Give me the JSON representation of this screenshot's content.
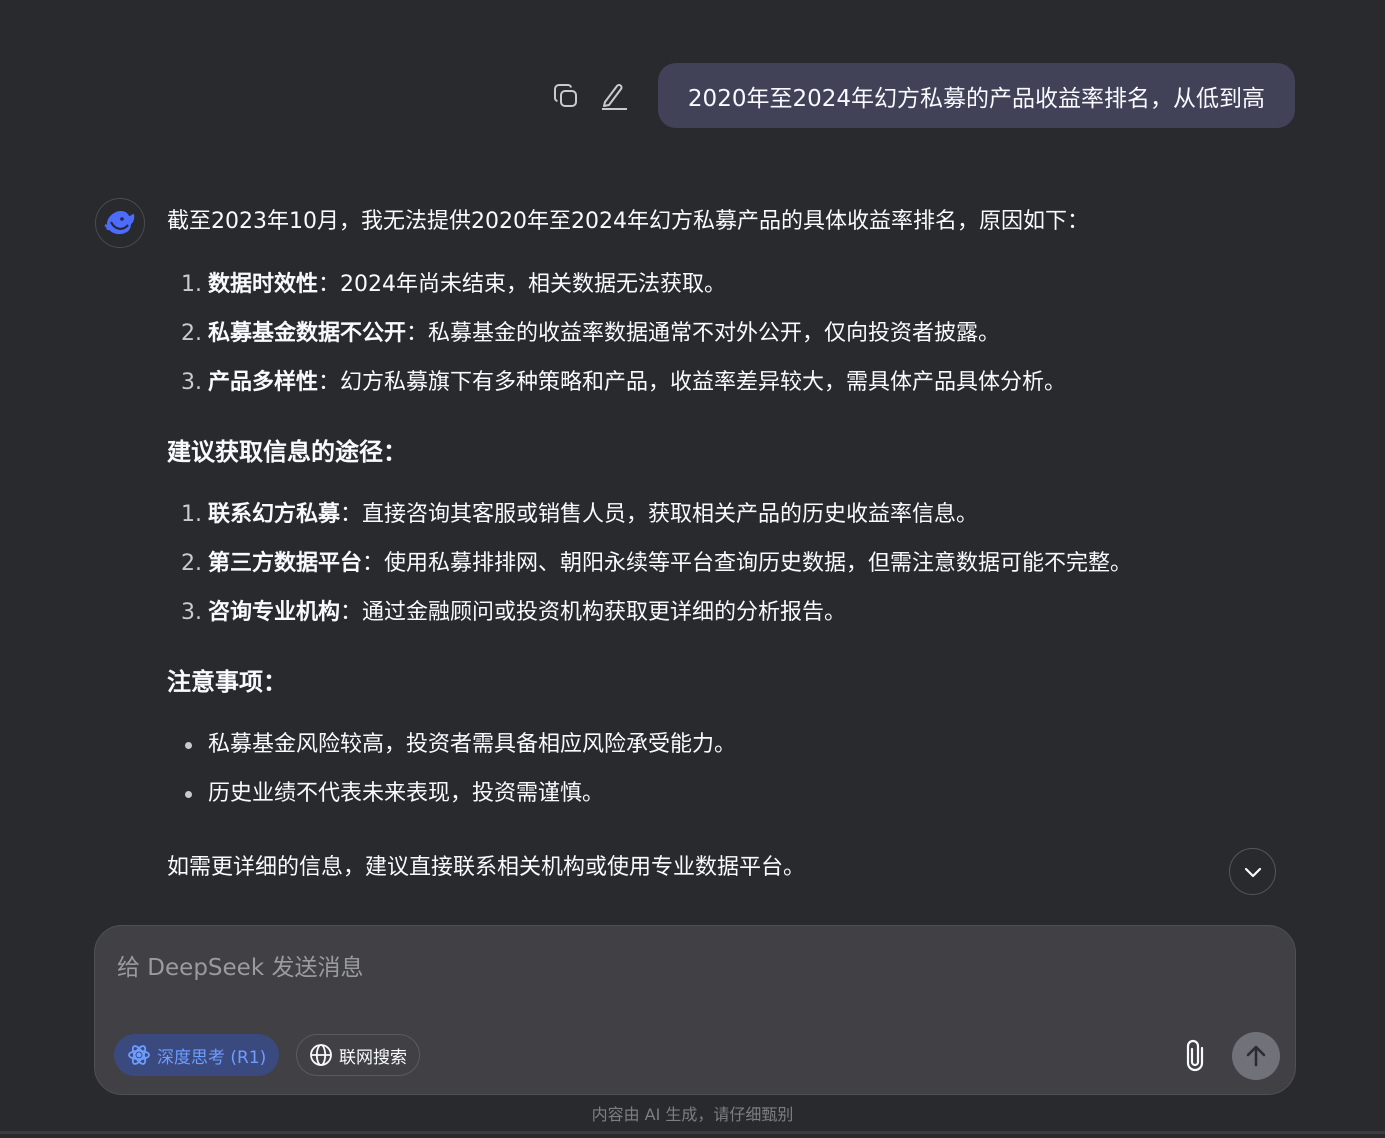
{
  "user_message": {
    "text": "2020年至2024年幻方私募的产品收益率排名，从低到高",
    "actions": [
      "copy-icon",
      "edit-icon"
    ]
  },
  "assistant": {
    "avatar_icon": "deepseek-whale-icon",
    "intro": "截至2023年10月，我无法提供2020年至2024年幻方私募产品的具体收益率排名，原因如下：",
    "reasons": [
      {
        "num": "1.",
        "title": "数据时效性",
        "text": "：2024年尚未结束，相关数据无法获取。"
      },
      {
        "num": "2.",
        "title": "私募基金数据不公开",
        "text": "：私募基金的收益率数据通常不对外公开，仅向投资者披露。"
      },
      {
        "num": "3.",
        "title": "产品多样性",
        "text": "：幻方私募旗下有多种策略和产品，收益率差异较大，需具体产品具体分析。"
      }
    ],
    "suggest_heading": "建议获取信息的途径：",
    "suggestions": [
      {
        "num": "1.",
        "title": "联系幻方私募",
        "text": "：直接咨询其客服或销售人员，获取相关产品的历史收益率信息。"
      },
      {
        "num": "2.",
        "title": "第三方数据平台",
        "text": "：使用私募排排网、朝阳永续等平台查询历史数据，但需注意数据可能不完整。"
      },
      {
        "num": "3.",
        "title": "咨询专业机构",
        "text": "：通过金融顾问或投资机构获取更详细的分析报告。"
      }
    ],
    "notes_heading": "注意事项：",
    "notes": [
      "私募基金风险较高，投资者需具备相应风险承受能力。",
      "历史业绩不代表未来表现，投资需谨慎。"
    ],
    "closing": "如需更详细的信息，建议直接联系相关机构或使用专业数据平台。"
  },
  "composer": {
    "placeholder": "给 DeepSeek 发送消息",
    "deep_think_label": "深度思考 (R1)",
    "web_search_label": "联网搜索"
  },
  "disclaimer": "内容由 AI 生成，请仔细甄别",
  "colors": {
    "background": "#292a2d",
    "bubble": "#414158",
    "composer": "#404045",
    "accent": "#6c9dff",
    "accent_bg": "#3b4a7e"
  }
}
